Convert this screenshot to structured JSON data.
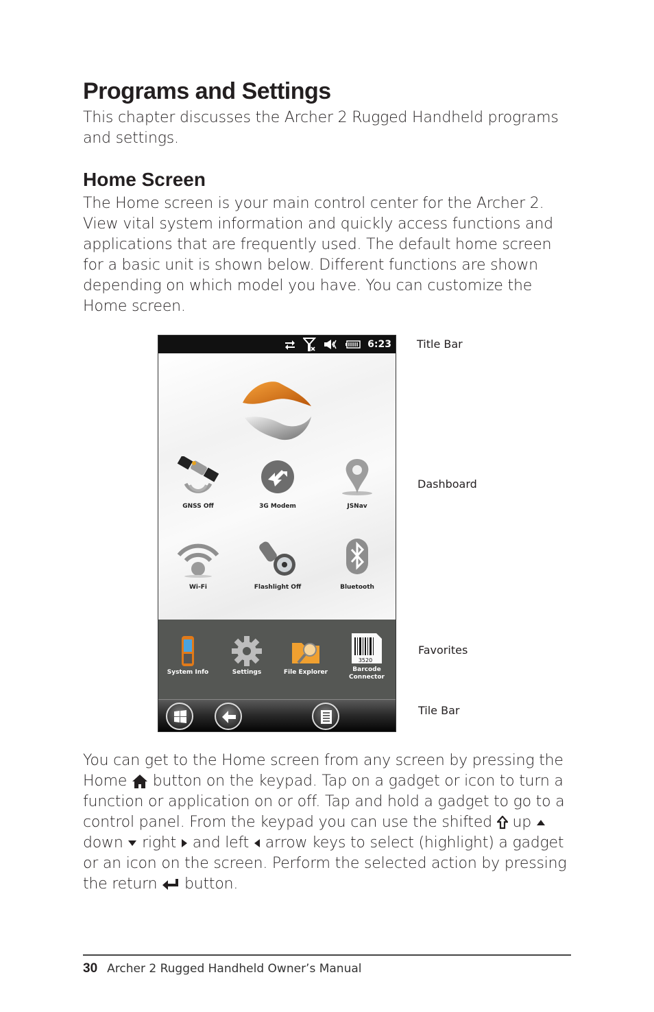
{
  "heading": "Programs and Settings",
  "intro": "This chapter discusses the Archer 2 Rugged Handheld programs and settings.",
  "section": {
    "title": "Home Screen",
    "paragraph": "The Home screen is your main control center for the Archer 2. View vital system information and quickly access functions and applications that are frequently used. The default home screen for a basic unit is shown below. Different functions are shown depending on which model you have. You can customize the Home screen."
  },
  "screen": {
    "status_icons": [
      "sync-icon",
      "no-signal-icon",
      "speaker-muted-icon",
      "battery-icon"
    ],
    "time": "6:23",
    "gadgets": [
      {
        "label": "GNSS Off",
        "icon": "satellite-icon"
      },
      {
        "label": "3G Modem",
        "icon": "modem-arrows-icon"
      },
      {
        "label": "JSNav",
        "icon": "map-pin-icon"
      },
      {
        "label": "Wi-Fi",
        "icon": "wifi-icon"
      },
      {
        "label": "Flashlight Off",
        "icon": "flashlight-icon"
      },
      {
        "label": "Bluetooth",
        "icon": "bluetooth-icon"
      }
    ],
    "favorites": [
      {
        "label": "System Info",
        "icon": "handheld-device-icon"
      },
      {
        "label": "Settings",
        "icon": "gear-icon"
      },
      {
        "label": "File Explorer",
        "icon": "folder-search-icon"
      },
      {
        "label_line1": "Barcode",
        "label_line2": "Connector",
        "icon": "barcode-icon",
        "barcode_number": "3520"
      }
    ],
    "tile_buttons": [
      "windows-start-icon",
      "back-arrow-icon",
      "menu-list-icon"
    ]
  },
  "callouts": {
    "title_bar": "Title Bar",
    "dashboard": "Dashboard",
    "favorites": "Favorites",
    "tile_bar": "Tile Bar"
  },
  "instructions": {
    "part1": "You can get to the Home screen from any screen by pressing the Home",
    "part2": "button on the keypad. Tap on a gadget or icon to turn a function or application on or off. Tap and hold a gadget to go to a control panel. From the keypad you can use the shifted",
    "part3": "up",
    "part4": "down",
    "part5": "right",
    "part6": "and left",
    "part7": "arrow keys to select (highlight) a gadget or an icon on the screen. Perform the selected action by pressing the return",
    "part8": "button."
  },
  "footer": {
    "page_number": "30",
    "title": "Archer 2 Rugged Handheld Owner’s Manual"
  }
}
